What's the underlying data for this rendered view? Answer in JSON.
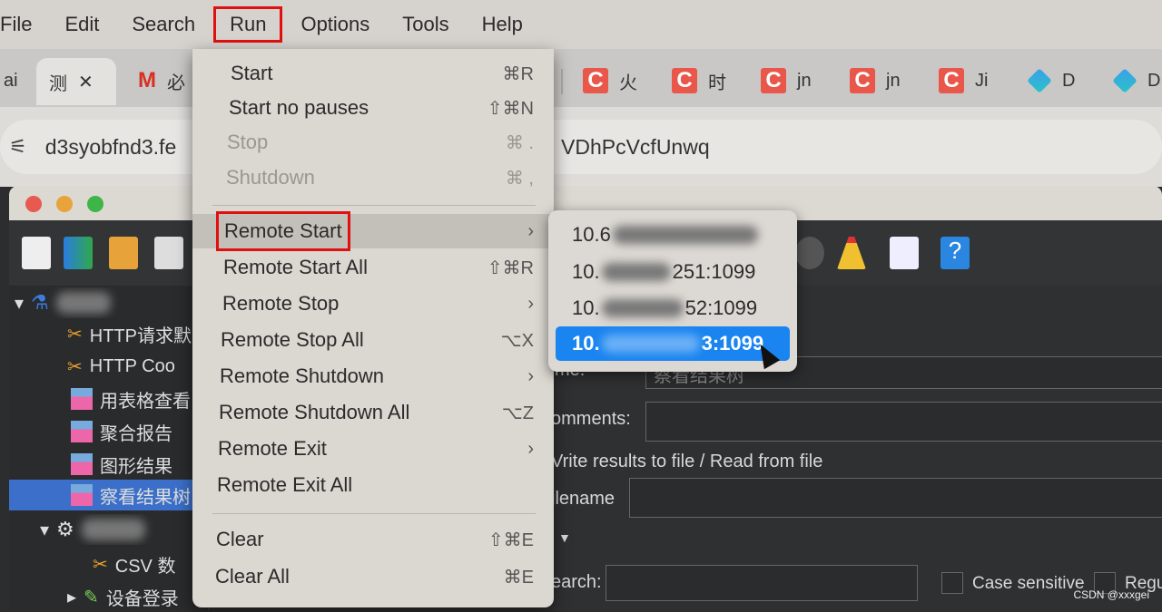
{
  "menubar": {
    "items": [
      "File",
      "Edit",
      "Search",
      "Run",
      "Options",
      "Tools",
      "Help"
    ],
    "active": "Run"
  },
  "browser": {
    "tabs": [
      {
        "label": "ai"
      },
      {
        "label": "测",
        "close": "✕"
      },
      {
        "label": "必",
        "icon": "gmail-icon"
      },
      {
        "label": "火",
        "icon": "csdn-icon"
      },
      {
        "label": "时",
        "icon": "csdn-icon"
      },
      {
        "label": "jn",
        "icon": "csdn-icon"
      },
      {
        "label": "jn",
        "icon": "csdn-icon"
      },
      {
        "label": "Ji",
        "icon": "csdn-icon"
      },
      {
        "label": "D",
        "icon": "app-icon"
      },
      {
        "label": "D",
        "icon": "app-icon"
      }
    ],
    "address_left": "d3syobfnd3.fe",
    "address_right": "VDhPcVcfUnwq"
  },
  "tree": {
    "items": [
      {
        "label": "HTTP请求默"
      },
      {
        "label": "HTTP Coo"
      },
      {
        "label": "用表格查看"
      },
      {
        "label": "聚合报告"
      },
      {
        "label": "图形结果"
      },
      {
        "label": "察看结果树",
        "selected": true
      },
      {
        "label": "CSV 数"
      },
      {
        "label": "设备登录"
      }
    ]
  },
  "content": {
    "name_label": "me:",
    "name_value": "察看结果树",
    "comments_label": "omments:",
    "section": "Vrite results to file / Read from file",
    "filename_label": "ilename",
    "search_label": "earch:",
    "case_sensitive": "Case sensitive",
    "regex": "Regu"
  },
  "run_menu": {
    "items": [
      {
        "label": "Start",
        "shortcut": "⌘R"
      },
      {
        "label": "Start no pauses",
        "shortcut": "⇧⌘N"
      },
      {
        "label": "Stop",
        "shortcut": "⌘ .",
        "disabled": true
      },
      {
        "label": "Shutdown",
        "shortcut": "⌘ ,",
        "disabled": true
      },
      {
        "label": "Remote Start",
        "submenu": "›",
        "highlighted": true
      },
      {
        "label": "Remote Start All",
        "shortcut": "⇧⌘R"
      },
      {
        "label": "Remote Stop",
        "submenu": "›"
      },
      {
        "label": "Remote Stop All",
        "shortcut": "⌥X"
      },
      {
        "label": "Remote Shutdown",
        "submenu": "›"
      },
      {
        "label": "Remote Shutdown All",
        "shortcut": "⌥Z"
      },
      {
        "label": "Remote Exit",
        "submenu": "›"
      },
      {
        "label": "Remote Exit All"
      },
      {
        "label": "Clear",
        "shortcut": "⇧⌘E"
      },
      {
        "label": "Clear All",
        "shortcut": "⌘E"
      }
    ]
  },
  "remote_start_submenu": {
    "items": [
      {
        "prefix": "10.6",
        "suffix": ""
      },
      {
        "prefix": "10.",
        "suffix": "251:1099"
      },
      {
        "prefix": "10.",
        "suffix": "52:1099"
      },
      {
        "prefix": "10.",
        "suffix": "3:1099",
        "selected": true
      }
    ]
  },
  "watermark": "CSDN @xxxgei",
  "colors": {
    "selection": "#1a84f0",
    "highlight_box": "#e01010",
    "tree_selection": "#3b6fc9"
  }
}
